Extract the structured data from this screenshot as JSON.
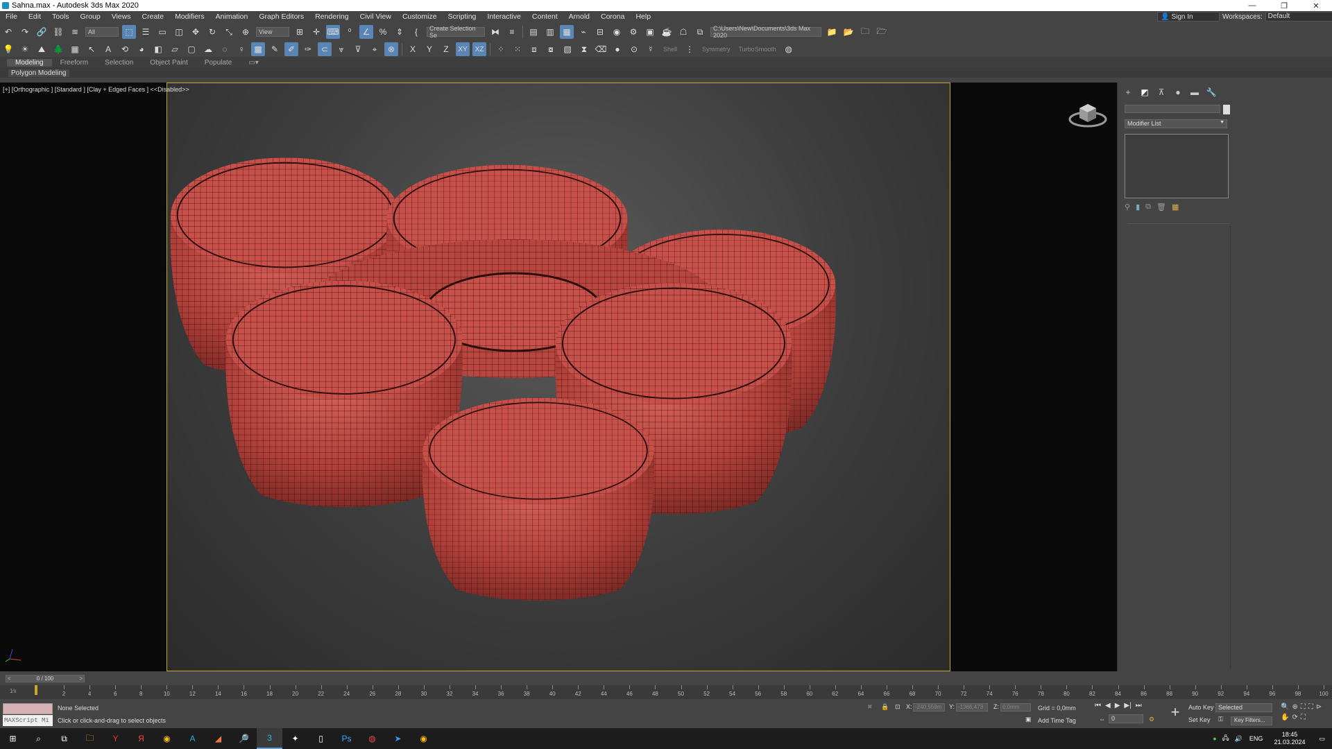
{
  "window": {
    "title": "Sahna.max - Autodesk 3ds Max 2020",
    "controls": [
      "—",
      "❐",
      "✕"
    ]
  },
  "menu": [
    "File",
    "Edit",
    "Tools",
    "Group",
    "Views",
    "Create",
    "Modifiers",
    "Animation",
    "Graph Editors",
    "Rendering",
    "Civil View",
    "Customize",
    "Scripting",
    "Interactive",
    "Content",
    "Arnold",
    "Corona",
    "Help"
  ],
  "account": {
    "sign_in": "Sign In",
    "workspaces_label": "Workspaces:",
    "workspace": "Default"
  },
  "toolbar": {
    "filter": "All",
    "ref_coord": "View",
    "named_selection": "Create Selection Se",
    "project_path": "C:\\Users\\New\\Documents\\3ds Max 2020",
    "axis_x": "X",
    "axis_y": "Y",
    "axis_z": "Z",
    "axis_xy": "XY",
    "axis_xz": "XZ",
    "shell": "Shell",
    "symmetry": "Symmetry",
    "turbosmooth": "TurboSmooth"
  },
  "ribbon": {
    "tabs": [
      "Modeling",
      "Freeform",
      "Selection",
      "Object Paint",
      "Populate"
    ],
    "active": "Modeling",
    "sub_label": "Polygon Modeling"
  },
  "viewport": {
    "label": "[+] [Orthographic ] [Standard ] [Clay + Edged Faces ]  <<Disabled>>",
    "mesh_color": "#c1473f",
    "wire_color": "#2a0c0a"
  },
  "panel": {
    "modifier_list": "Modifier List"
  },
  "timeline": {
    "slider": "0 / 100",
    "ticks": [
      2,
      4,
      6,
      8,
      10,
      12,
      14,
      16,
      18,
      20,
      22,
      24,
      26,
      28,
      30,
      32,
      34,
      36,
      38,
      40,
      42,
      44,
      46,
      48,
      50,
      52,
      54,
      56,
      58,
      60,
      62,
      64,
      66,
      68,
      70,
      72,
      74,
      76,
      78,
      80,
      82,
      84,
      86,
      88,
      90,
      92,
      94,
      96,
      98,
      100
    ],
    "key_mode": "1⁄x"
  },
  "status": {
    "selection": "None Selected",
    "prompt": "Click or click-and-drag to select objects",
    "maxscript": "MAXScript Mi",
    "x_label": "X:",
    "x_value": "-240,559m",
    "y_label": "Y:",
    "y_value": "-1366,473",
    "z_label": "Z:",
    "z_value": "0,0mm",
    "grid": "Grid = 0,0mm",
    "add_time_tag": "Add Time Tag",
    "frame": "0",
    "auto_key": "Auto Key",
    "set_key": "Set Key",
    "selected": "Selected",
    "key_filters": "Key Filters..."
  },
  "tray": {
    "lang": "ENG",
    "time": "18:45",
    "date": "21.03.2024"
  }
}
